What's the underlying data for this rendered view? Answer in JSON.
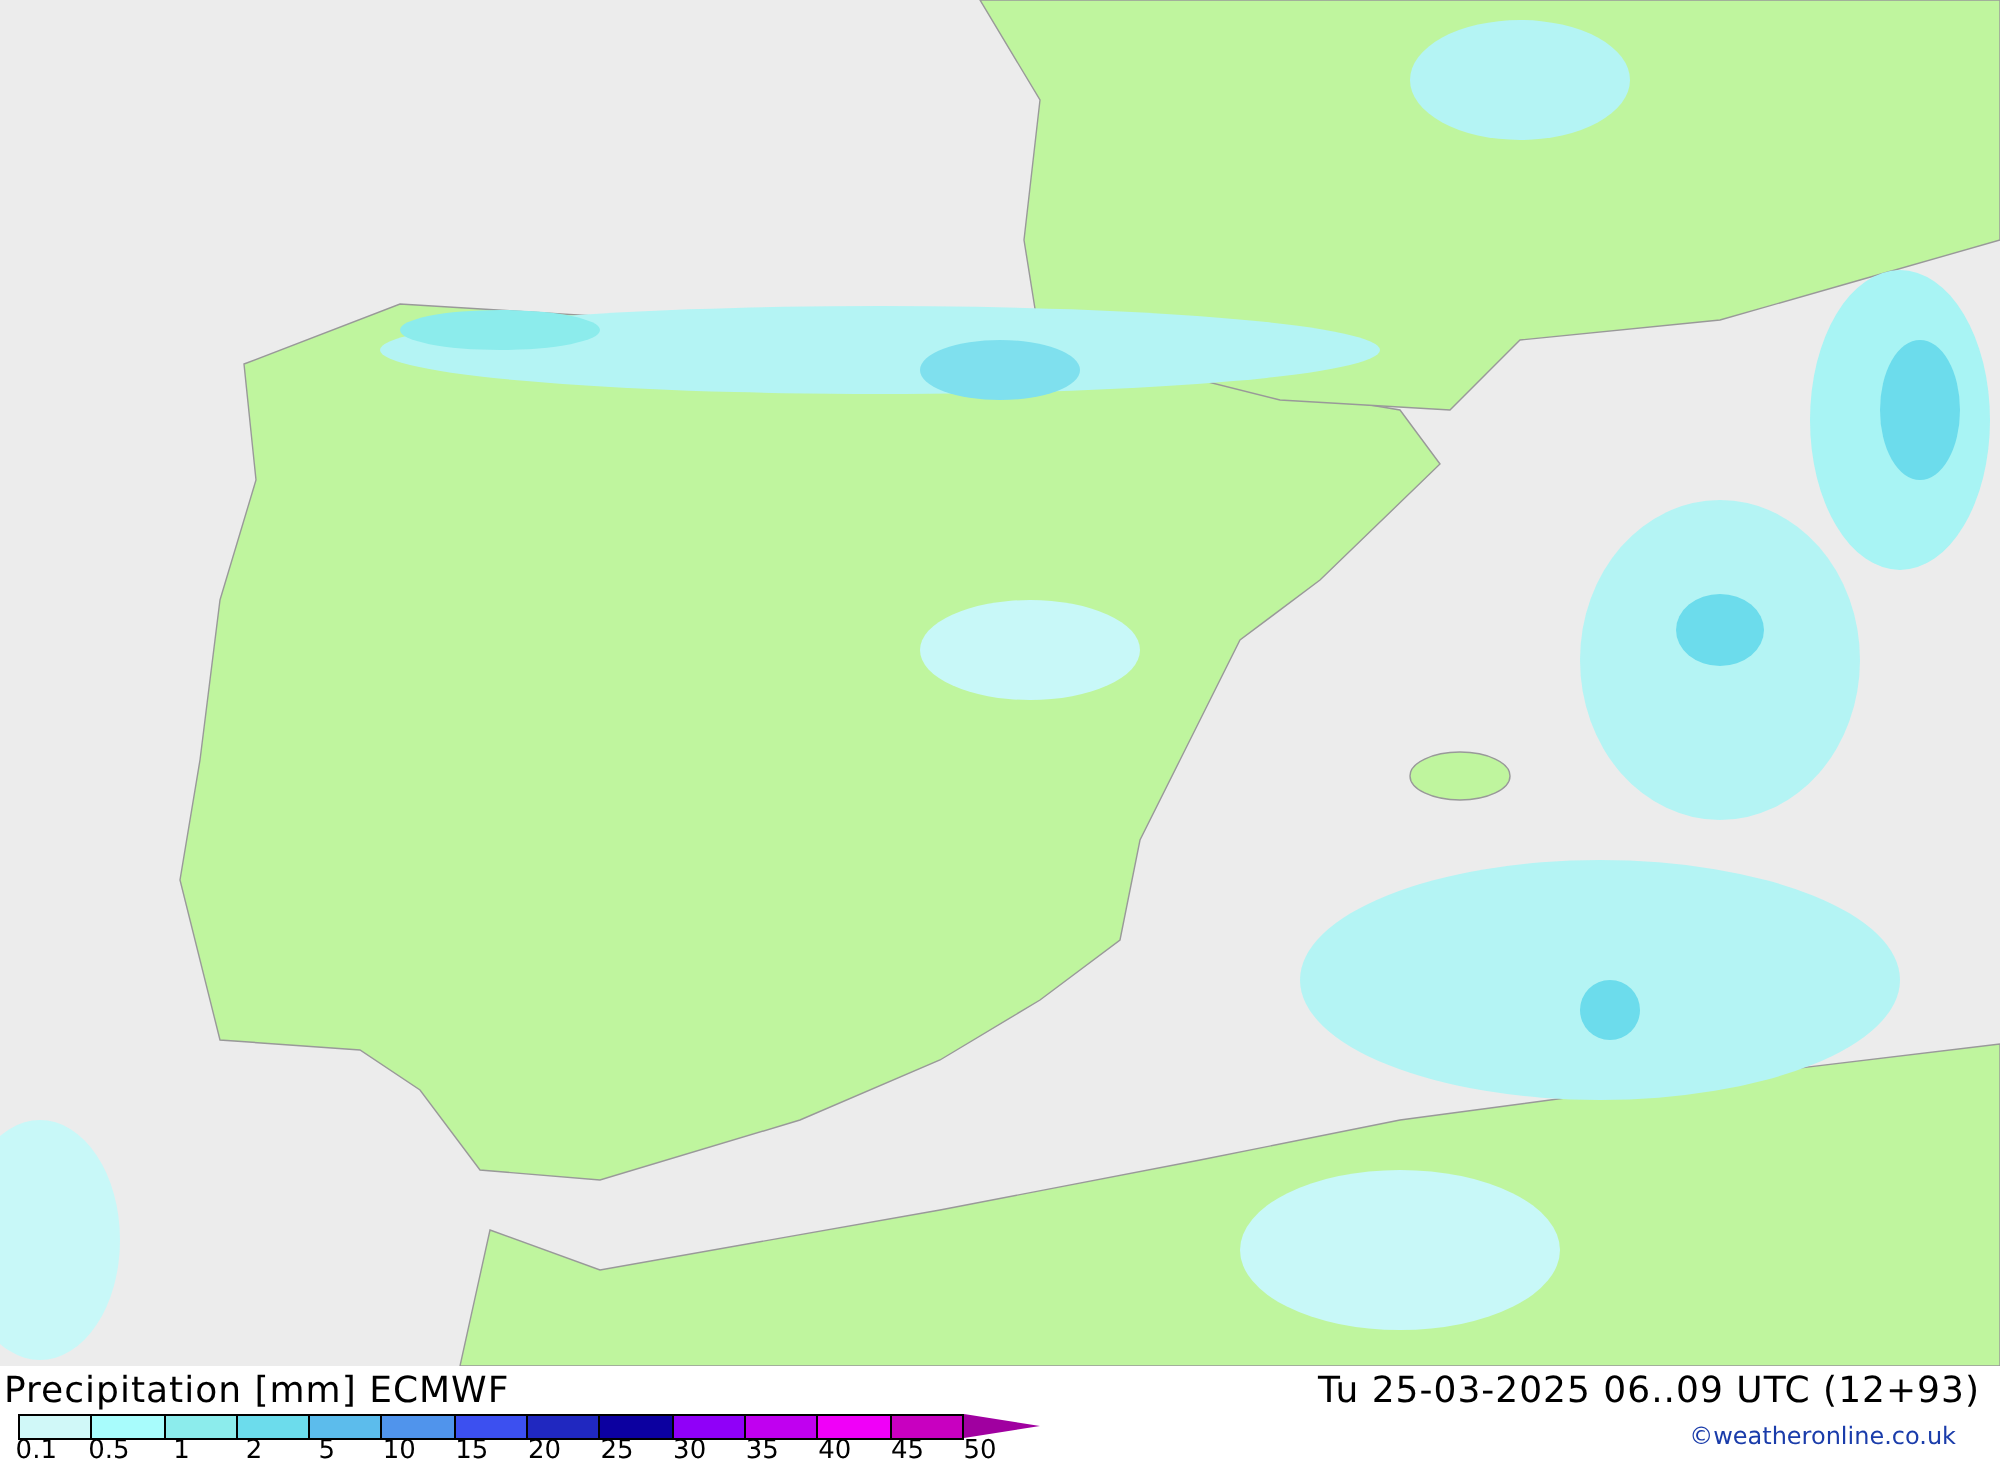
{
  "title": "Precipitation [mm] ECMWF",
  "valid_time": "Tu 25-03-2025 06..09 UTC (12+93)",
  "legend": [
    {
      "label": "0.1",
      "color": "#d0f8f8"
    },
    {
      "label": "0.5",
      "color": "#a8fcfc"
    },
    {
      "label": "1",
      "color": "#8cecec"
    },
    {
      "label": "2",
      "color": "#6cdcec"
    },
    {
      "label": "5",
      "color": "#5cbcec"
    },
    {
      "label": "10",
      "color": "#5094ec"
    },
    {
      "label": "15",
      "color": "#3c50f0"
    },
    {
      "label": "20",
      "color": "#2028c0"
    },
    {
      "label": "25",
      "color": "#0c00a0"
    },
    {
      "label": "30",
      "color": "#9000f8"
    },
    {
      "label": "35",
      "color": "#c000f0"
    },
    {
      "label": "40",
      "color": "#f000f8"
    },
    {
      "label": "45",
      "color": "#c800c0"
    },
    {
      "label": "50"
    }
  ],
  "copyright": "©weatheronline.co.uk"
}
